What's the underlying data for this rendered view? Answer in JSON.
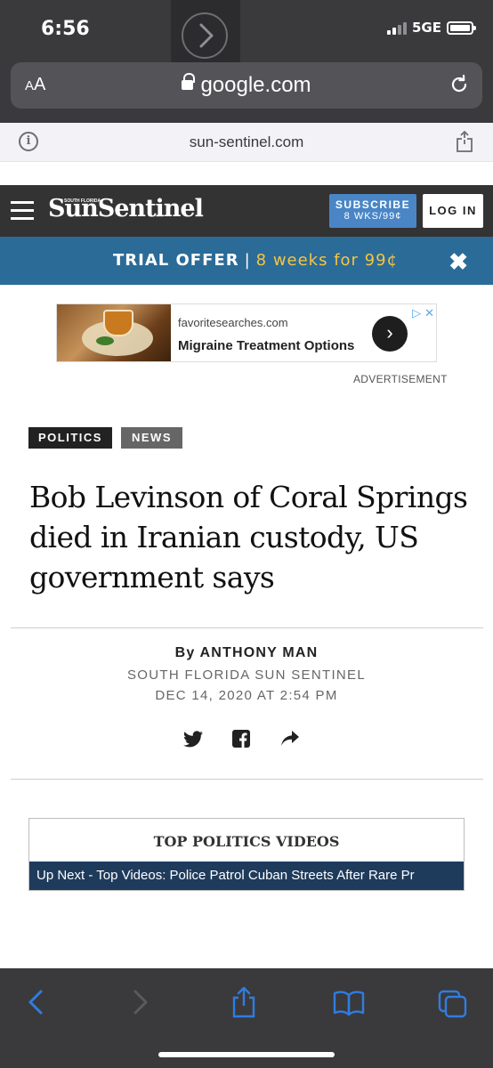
{
  "status_bar": {
    "time": "6:56",
    "network": "5GE"
  },
  "browser": {
    "text_size_label_small": "A",
    "text_size_label_large": "A",
    "url": "google.com",
    "site_domain": "sun-sentinel.com"
  },
  "site_header": {
    "logo_kicker": "SOUTH FLORIDA",
    "logo_text": "SunSentinel",
    "subscribe_line1": "SUBSCRIBE",
    "subscribe_line2": "8 WKS/99¢",
    "login_label": "LOG IN"
  },
  "trial_offer": {
    "label": "TRIAL OFFER",
    "separator": "|",
    "price": "8 weeks for 99¢",
    "close": "✖"
  },
  "ad": {
    "source": "favoritesearches.com",
    "title": "Migraine Treatment Options",
    "label": "ADVERTISEMENT"
  },
  "article": {
    "tags": [
      "POLITICS",
      "NEWS"
    ],
    "headline": "Bob Levinson of Coral Springs died in Iranian custody, US government says",
    "byline": "By ANTHONY MAN",
    "publication": "SOUTH FLORIDA SUN SENTINEL",
    "date": "DEC 14, 2020 AT 2:54 PM"
  },
  "social_icons": [
    "twitter-icon",
    "facebook-icon",
    "share-arrow-icon"
  ],
  "video_box": {
    "title": "TOP POLITICS VIDEOS",
    "up_next": "Up Next - Top Videos: Police Patrol Cuban Streets After Rare Pr"
  },
  "toolbar_icons": [
    "back-icon",
    "forward-icon",
    "share-icon",
    "bookmarks-icon",
    "tabs-icon"
  ],
  "colors": {
    "chrome": "#3a3a3c",
    "trial_bar": "#2b6b98",
    "trial_price": "#f5c542",
    "subscribe": "#4a86c6",
    "ios_blue": "#2f7de1",
    "video_bar": "#1f3b5c"
  }
}
